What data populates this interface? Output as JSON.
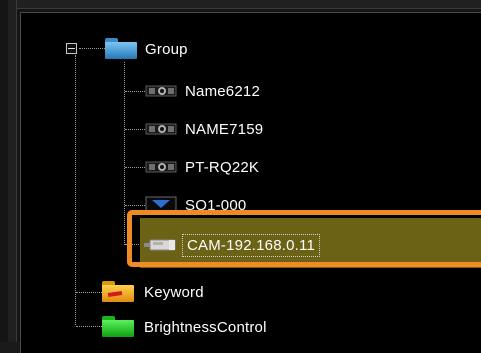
{
  "tree": {
    "root": {
      "label": "Group",
      "expanded": true,
      "icon": "blue-folder-icon"
    },
    "children": [
      {
        "label": "Name6212",
        "icon": "camera-icon"
      },
      {
        "label": "NAME7159",
        "icon": "camera-icon"
      },
      {
        "label": "PT-RQ22K",
        "icon": "camera-icon"
      },
      {
        "label": "SQ1-000",
        "icon": "monitor-icon"
      },
      {
        "label": "CAM-192.168.0.11",
        "icon": "bullet-camera-icon",
        "selected": true
      }
    ],
    "siblings": [
      {
        "label": "Keyword",
        "icon": "keyword-folder-icon"
      },
      {
        "label": "BrightnessControl",
        "icon": "green-folder-icon"
      }
    ]
  },
  "colors": {
    "background": "#000000",
    "selection": "#6b6216",
    "focus_ring": "#f08a24",
    "text": "#ffffff"
  }
}
